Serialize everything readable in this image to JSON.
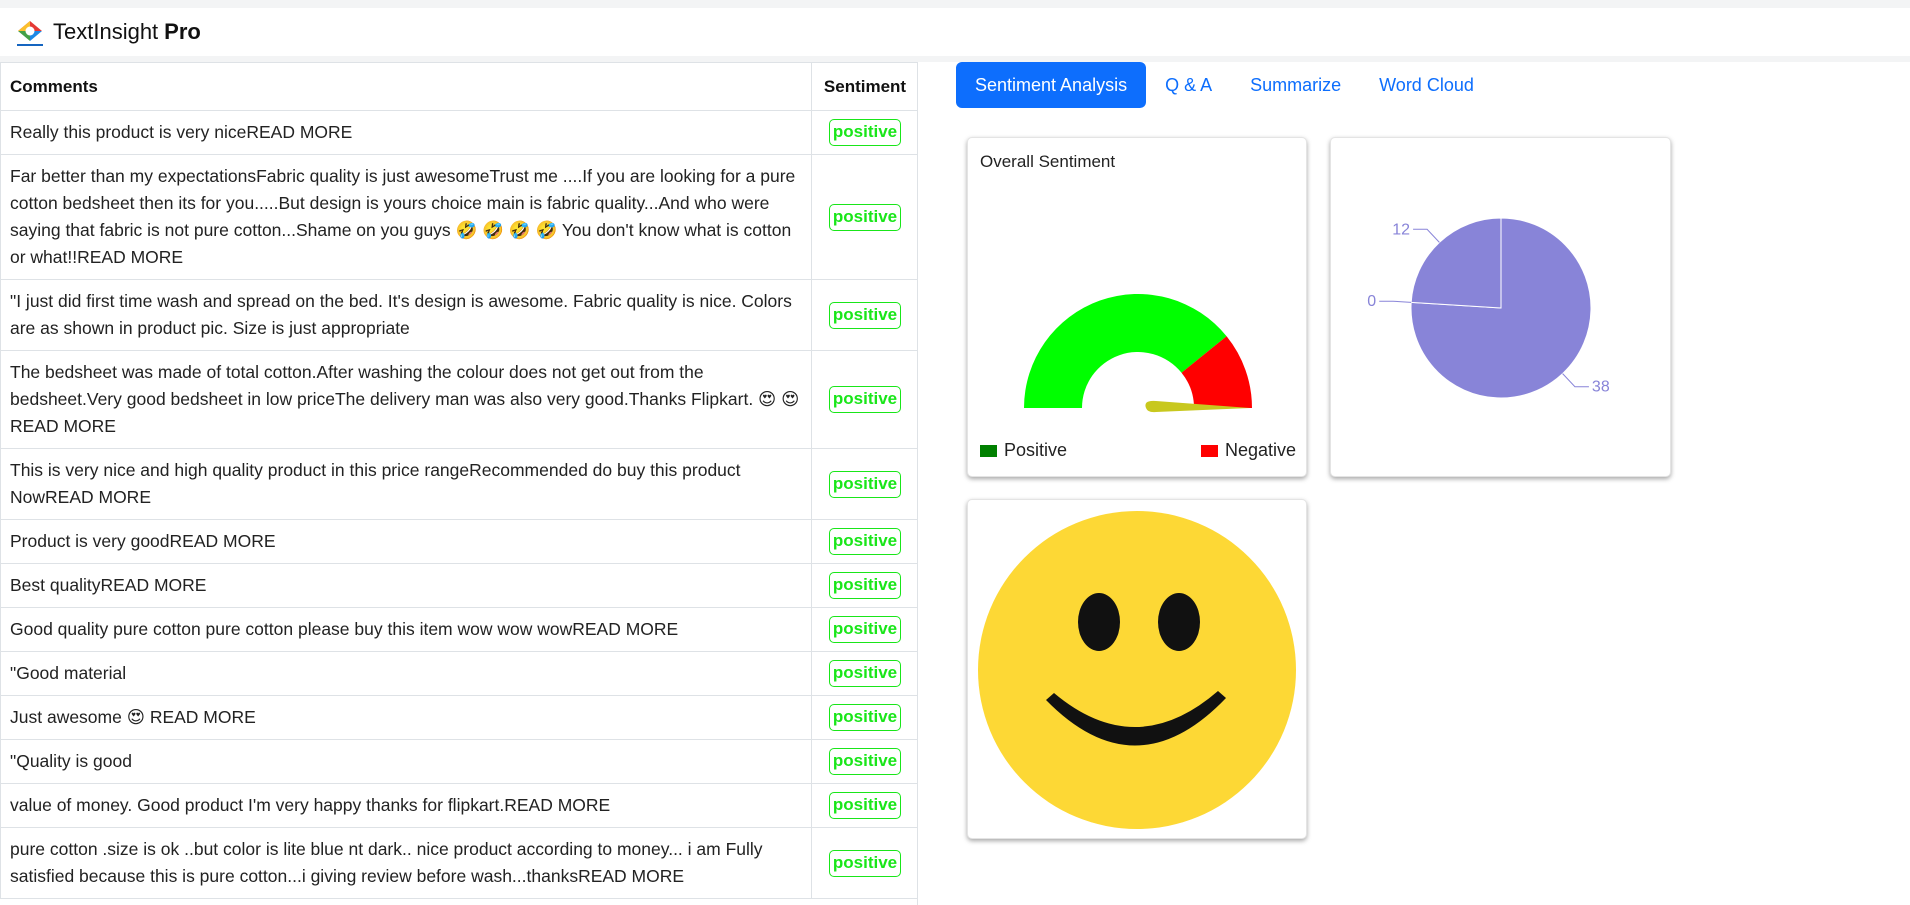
{
  "app": {
    "name": "TextInsight",
    "suffix": "Pro"
  },
  "table": {
    "headers": {
      "comments": "Comments",
      "sentiment": "Sentiment"
    },
    "rows": [
      {
        "comment": "Really this product is very niceREAD MORE",
        "sentiment": "positive"
      },
      {
        "comment": "Far better than my expectationsFabric quality is just awesomeTrust me ....If you are looking for a pure cotton bedsheet then its for you.....But design is yours choice main is fabric quality...And who were saying that fabric is not pure cotton...Shame on you guys 🤣 🤣 🤣 🤣 You don't know what is cotton or what!!READ MORE",
        "sentiment": "positive"
      },
      {
        "comment": "\"I just did first time wash and spread on the bed. It's design is awesome. Fabric quality is nice. Colors are as shown in product pic. Size is just appropriate",
        "sentiment": "positive"
      },
      {
        "comment": "The bedsheet was made of total cotton.After washing the colour does not get out from the bedsheet.Very good bedsheet in low priceThe delivery man was also very good.Thanks Flipkart. 😍 😍 READ MORE",
        "sentiment": "positive"
      },
      {
        "comment": "This is very nice and high quality product in this price rangeRecommended do buy this product NowREAD MORE",
        "sentiment": "positive"
      },
      {
        "comment": "Product is very goodREAD MORE",
        "sentiment": "positive"
      },
      {
        "comment": "Best qualityREAD MORE",
        "sentiment": "positive"
      },
      {
        "comment": "Good quality pure cotton pure cotton please buy this item wow wow wowREAD MORE",
        "sentiment": "positive"
      },
      {
        "comment": "\"Good material",
        "sentiment": "positive"
      },
      {
        "comment": "Just awesome 😍 READ MORE",
        "sentiment": "positive"
      },
      {
        "comment": "\"Quality is good",
        "sentiment": "positive"
      },
      {
        "comment": "value of money. Good product I'm very happy thanks for flipkart.READ MORE",
        "sentiment": "positive"
      },
      {
        "comment": "pure cotton .size is ok ..but color is lite blue nt dark.. nice product according to money... i am Fully satisfied because this is pure cotton...i giving review before wash...thanksREAD MORE",
        "sentiment": "positive"
      }
    ]
  },
  "tabs": [
    {
      "label": "Sentiment Analysis",
      "active": true
    },
    {
      "label": "Q & A",
      "active": false
    },
    {
      "label": "Summarize",
      "active": false
    },
    {
      "label": "Word Cloud",
      "active": false
    }
  ],
  "gauge": {
    "title": "Overall Sentiment",
    "legend_positive": "Positive",
    "legend_negative": "Negative",
    "color_positive": "#00ff00",
    "color_negative": "#ff0000",
    "legend_color_positive": "#008000",
    "needle_color": "#c8c81e"
  },
  "chart_data": {
    "type": "pie",
    "labels_shown": [
      "38",
      "0",
      "12"
    ],
    "values": [
      38,
      0,
      12
    ],
    "color": "#8884d8"
  },
  "smiley": {
    "face_color": "#fdd835",
    "feature_color": "#111111"
  }
}
